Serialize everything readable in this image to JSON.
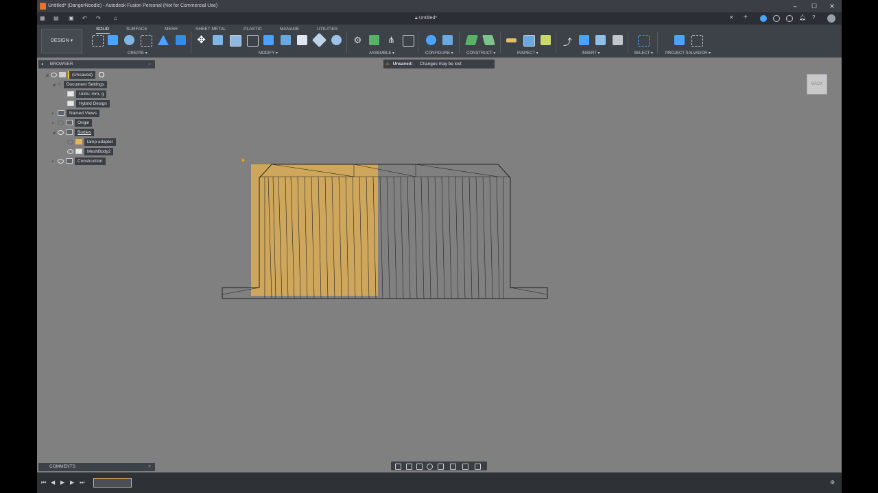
{
  "window": {
    "title": "Untitled* (DangerNoodle) - Autodesk Fusion Personal (Not for Commercial Use)",
    "minimize": "–",
    "maximize": "☐",
    "close": "✕"
  },
  "tabbar": {
    "doc_tab": "Untitled*",
    "tab_close": "✕",
    "new_tab": "+"
  },
  "toolbar": {
    "workspace": "DESIGN",
    "tabs": [
      "SOLID",
      "SURFACE",
      "MESH",
      "SHEET METAL",
      "PLASTIC",
      "MANAGE",
      "UTILITIES"
    ],
    "active_tab": "SOLID",
    "groups": [
      "CREATE",
      "MODIFY",
      "ASSEMBLE",
      "CONFIGURE",
      "CONSTRUCT",
      "INSPECT",
      "INSERT",
      "SELECT",
      "PROJECT SALVADOR"
    ]
  },
  "browser": {
    "title": "BROWSER",
    "nodes": [
      "(Unsaved)",
      "Document Settings",
      "Units: mm, g",
      "Hybrid Design",
      "Named Views",
      "Origin",
      "Bodies",
      "lamp adapter",
      "MeshBody2",
      "Construction"
    ]
  },
  "warning": {
    "label": "Unsaved:",
    "message": "Changes may be lost"
  },
  "viewcube": {
    "face": "BACK"
  },
  "comments": {
    "title": "COMMENTS",
    "add": "+"
  },
  "colors": {
    "accent": "#f0a020",
    "body_highlight": "#e8b450",
    "viewport": "#808080"
  }
}
